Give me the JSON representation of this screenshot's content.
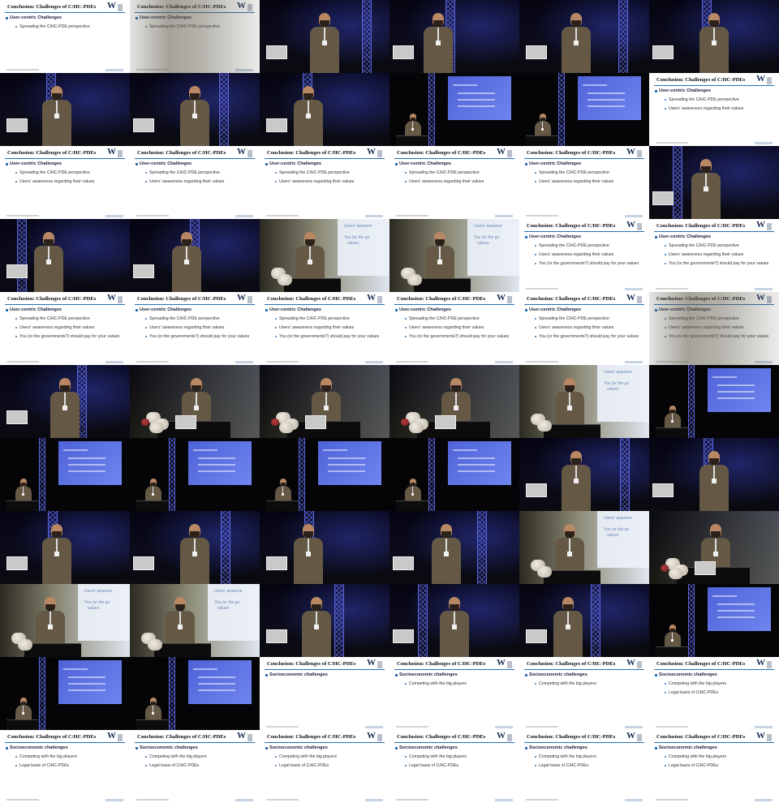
{
  "slides": {
    "a": {
      "title": "Conclusion: Challenges of C/HC-PDEs",
      "heading": "User-centric Challenges",
      "items": [
        "Spreading the C/HC-PDE perspective",
        "",
        ""
      ]
    },
    "b": {
      "title": "Conclusion: Challenges of C/HC-PDEs",
      "heading": "User-centric Challenges",
      "items": [
        "Spreading the C/HC-PDE perspective",
        "Users' awareness regarding their values",
        ""
      ]
    },
    "c": {
      "title": "Conclusion: Challenges of C/HC-PDEs",
      "heading": "User-centric Challenges",
      "items": [
        "Spreading the C/HC-PDE perspective",
        "Users' awareness regarding their values",
        "You (or the governments?) should pay for your values"
      ]
    },
    "d": {
      "title": "Conclusion: Challenges of C/HC-PDEs",
      "heading": "Socioeconomic challenges",
      "items": [
        "",
        "",
        ""
      ]
    },
    "e": {
      "title": "Conclusion: Challenges of C/HC-PDEs",
      "heading": "Socioeconomic challenges",
      "items": [
        "Competing with the big players",
        "",
        ""
      ]
    },
    "f": {
      "title": "Conclusion: Challenges of C/HC-PDEs",
      "heading": "Socioeconomic challenges",
      "items": [
        "Competing with the big players",
        "Legal basis of C/HC-PDEs",
        ""
      ]
    }
  },
  "projected_text": {
    "users": "Users' awarene",
    "you": "You (or the go",
    "values": "values"
  },
  "grid": [
    [
      "slide:a",
      "slide:a:blur",
      "speaker",
      "speaker",
      "speaker",
      "speaker"
    ],
    [
      "speaker",
      "speaker",
      "speaker",
      "wide:blue",
      "wide:blue",
      "slide:b"
    ],
    [
      "slide:b",
      "slide:b",
      "slide:b",
      "slide:b",
      "slide:b",
      "speaker"
    ],
    [
      "speaker",
      "speaker",
      "wash",
      "wash",
      "slide:c",
      "slide:c"
    ],
    [
      "slide:c",
      "slide:c",
      "slide:c",
      "slide:c",
      "slide:c",
      "slide:c:blur"
    ],
    [
      "speaker",
      "podium",
      "podium",
      "podium",
      "wash",
      "wide:blue"
    ],
    [
      "wide:blue",
      "wide:blue",
      "wide:blue",
      "wide:blue",
      "speaker",
      "speaker"
    ],
    [
      "speaker",
      "speaker",
      "speaker",
      "speaker",
      "wash",
      "podium"
    ],
    [
      "wash",
      "wash",
      "speaker",
      "speaker",
      "speaker",
      "wide:blue"
    ],
    [
      "wide:blue",
      "wide:blue",
      "slide:d",
      "slide:e",
      "slide:e",
      "slide:f"
    ],
    [
      "slide:f",
      "slide:f",
      "slide:f",
      "slide:f",
      "slide:f",
      "slide:f"
    ]
  ],
  "colors": {
    "accent": "#2a6fb0",
    "truss": "#5a63d8",
    "projection_blue": "#5a6fe0"
  }
}
